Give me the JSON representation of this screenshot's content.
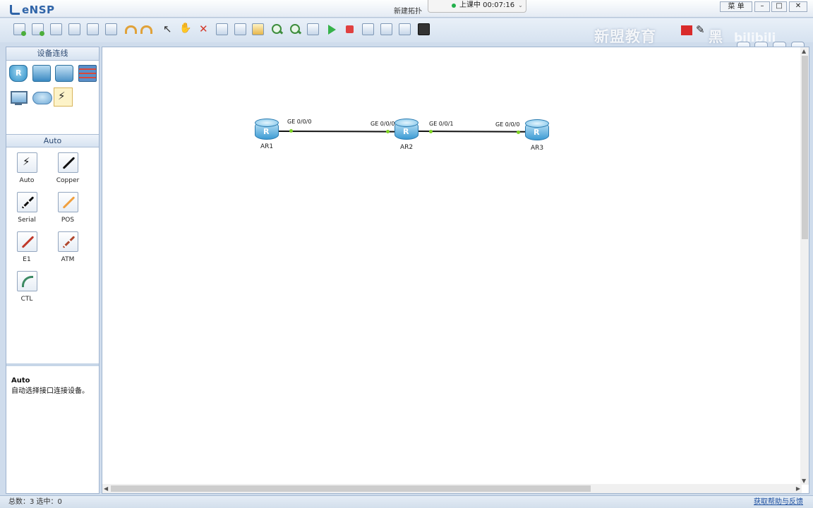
{
  "window": {
    "app_name": "eNSP",
    "title": "新建拓扑",
    "class_status": "上课中 00:07:16",
    "menu_label": "菜 单",
    "minimize": "–",
    "maximize": "□",
    "close": "✕"
  },
  "watermark": {
    "text": "新盟教育",
    "text2": "黑",
    "bili": "bilibili"
  },
  "left_panel": {
    "devices_header": "设备连线",
    "cables_header": "Auto",
    "cables": [
      {
        "label": "Auto",
        "color": "#111111"
      },
      {
        "label": "Copper",
        "color": "#111111"
      },
      {
        "label": "Serial",
        "color": "#111111"
      },
      {
        "label": "POS",
        "color": "#f0a040"
      },
      {
        "label": "E1",
        "color": "#c0392b"
      },
      {
        "label": "ATM",
        "color": "#b0482f"
      },
      {
        "label": "CTL",
        "color": "#3c8a63"
      }
    ],
    "description": {
      "title": "Auto",
      "text": "自动选择接口连接设备。"
    }
  },
  "topology": {
    "routers": [
      {
        "name": "AR1"
      },
      {
        "name": "AR2"
      },
      {
        "name": "AR3"
      }
    ],
    "ports": [
      {
        "label": "GE 0/0/0"
      },
      {
        "label": "GE 0/0/0"
      },
      {
        "label": "GE 0/0/1"
      },
      {
        "label": "GE 0/0/0"
      }
    ]
  },
  "statusbar": {
    "summary": "总数：3  选中：0",
    "help": "获取帮助与反馈"
  }
}
